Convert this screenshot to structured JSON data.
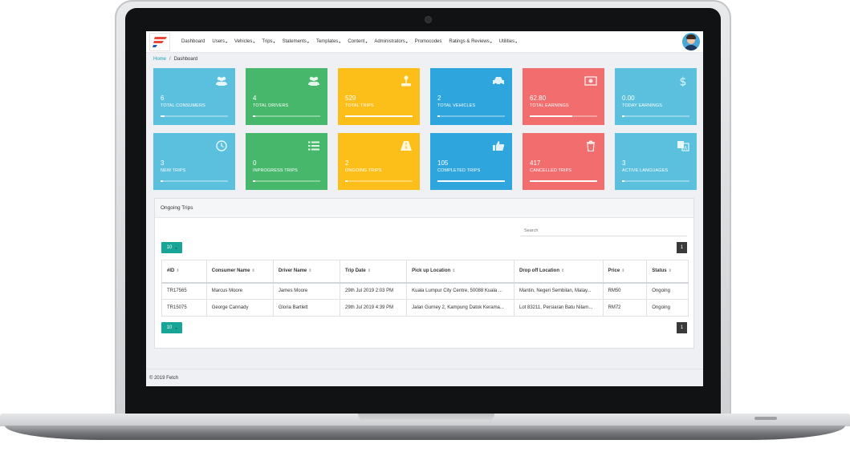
{
  "nav": {
    "items": [
      {
        "label": "Dashboard",
        "caret": false
      },
      {
        "label": "Users",
        "caret": true
      },
      {
        "label": "Vehicles",
        "caret": true
      },
      {
        "label": "Trips",
        "caret": true
      },
      {
        "label": "Statements",
        "caret": true
      },
      {
        "label": "Templates",
        "caret": true
      },
      {
        "label": "Content",
        "caret": true
      },
      {
        "label": "Administrators",
        "caret": true
      },
      {
        "label": "Promocodes",
        "caret": false
      },
      {
        "label": "Ratings & Reviews",
        "caret": true
      },
      {
        "label": "Utilities",
        "caret": true
      }
    ]
  },
  "breadcrumb": {
    "home": "Home",
    "separator": "/",
    "current": "Dashboard"
  },
  "tiles": [
    {
      "value": "6",
      "label": "Total Consumers",
      "icon": "users-icon",
      "progress": 0.06
    },
    {
      "value": "4",
      "label": "Total Drivers",
      "icon": "users-icon",
      "progress": 0.04
    },
    {
      "value": "529",
      "label": "Total Trips",
      "icon": "joystick-icon",
      "progress": 1.0
    },
    {
      "value": "2",
      "label": "Total Vehicles",
      "icon": "car-icon",
      "progress": 0.02
    },
    {
      "value": "62.80",
      "label": "Total Earnings",
      "icon": "money-icon",
      "progress": 0.63
    },
    {
      "value": "0.00",
      "label": "Today Earnings",
      "icon": "dollar-icon",
      "progress": 0.0
    },
    {
      "value": "3",
      "label": "New Trips",
      "icon": "clock-icon",
      "progress": 0.03
    },
    {
      "value": "0",
      "label": "Inprogress Trips",
      "icon": "list-icon",
      "progress": 0.0
    },
    {
      "value": "2",
      "label": "Ongoing Trips",
      "icon": "road-icon",
      "progress": 0.02
    },
    {
      "value": "105",
      "label": "Completed Trips",
      "icon": "thumbs-up-icon",
      "progress": 1.0
    },
    {
      "value": "417",
      "label": "Cancelled Trips",
      "icon": "trash-icon",
      "progress": 1.0
    },
    {
      "value": "3",
      "label": "Active Languages",
      "icon": "translate-icon",
      "progress": 0.03
    }
  ],
  "colors": {
    "cyan": "#5bc0de",
    "green": "#47b86b",
    "yellow": "#fcbf1a",
    "blue": "#2fa5de",
    "red": "#f26d6d",
    "teal_button": "#17a598"
  },
  "card": {
    "title": "Ongoing Trips",
    "search_placeholder": "Search",
    "per_page": "10",
    "page": "1",
    "columns": [
      "#ID",
      "Consumer Name",
      "Driver Name",
      "Trip Date",
      "Pick up Location",
      "Drop off Location",
      "Price",
      "Status"
    ],
    "rows": [
      [
        "TR17565",
        "Marcus Moore",
        "James Moore",
        "29th Jul 2019 2:03 PM",
        "Kuala Lumpur City Centre, 50088 Kuala ...",
        "Mantin, Negeri Sembilan, Malay...",
        "RM50",
        "Ongoing"
      ],
      [
        "TR15075",
        "George Cannady",
        "Gloria Bartlett",
        "29th Jul 2019 4:39 PM",
        "Jalan Gurney 2, Kampung Datok Kerama...",
        "Lot 83211, Persiaran Batu Nilam...",
        "RM72",
        "Ongoing"
      ]
    ]
  },
  "footer": {
    "text": "© 2019 Fetch"
  }
}
